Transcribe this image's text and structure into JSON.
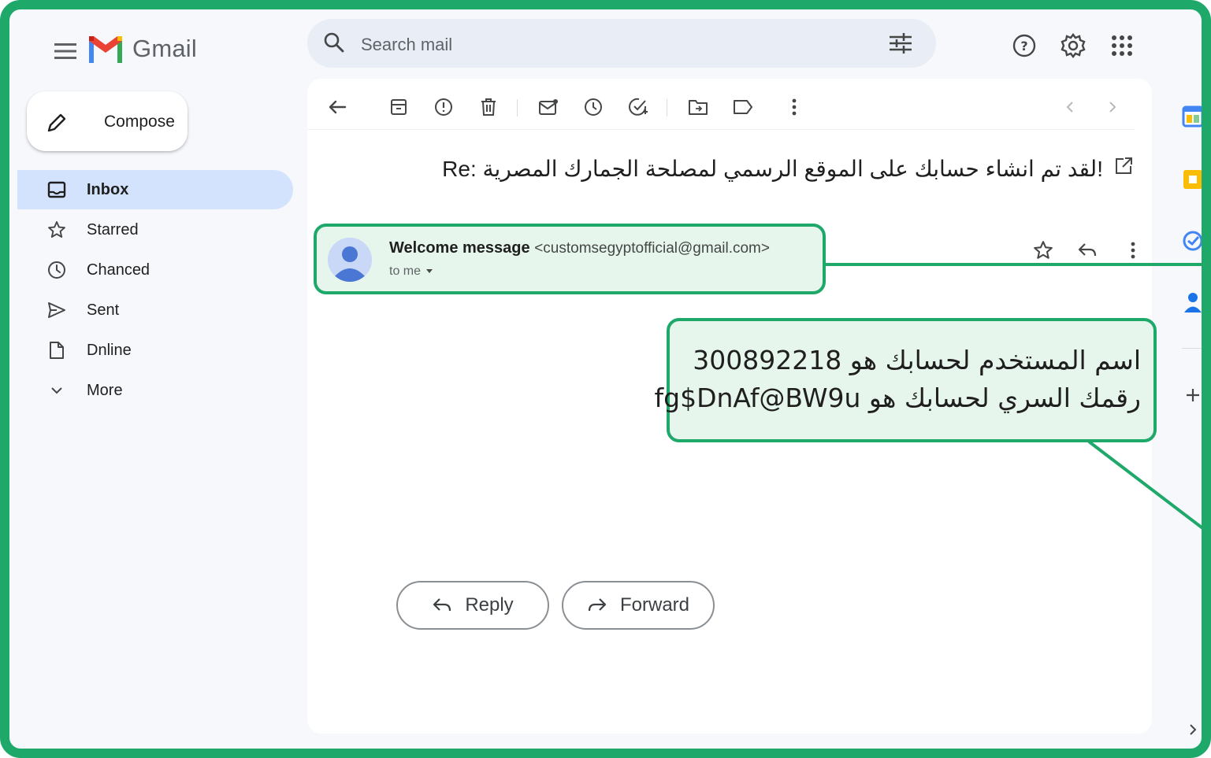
{
  "app": {
    "name": "Gmail"
  },
  "search": {
    "placeholder": "Search mail"
  },
  "compose": {
    "label": "Compose"
  },
  "nav": {
    "items": [
      {
        "label": "Inbox",
        "icon": "inbox-icon",
        "active": true
      },
      {
        "label": "Starred",
        "icon": "star-icon",
        "active": false
      },
      {
        "label": "Chanced",
        "icon": "clock-icon",
        "active": false
      },
      {
        "label": "Sent",
        "icon": "send-icon",
        "active": false
      },
      {
        "label": "Dnline",
        "icon": "file-icon",
        "active": false
      },
      {
        "label": "More",
        "icon": "chevron-down-icon",
        "active": false
      }
    ]
  },
  "email": {
    "subject": "Re: لقد تم انشاء حسابك على الموقع الرسمي لمصلحة الجمارك المصرية!",
    "sender_name": "Welcome message",
    "sender_email": "<customsegyptofficial@gmail.com>",
    "to_line": "to me",
    "body_lines": [
      "اسم المستخدم لحسابك هو 300892218",
      "رقمك السري لحسابك هو fg$DnAf@BW9u"
    ]
  },
  "actions": {
    "reply_label": "Reply",
    "forward_label": "Forward"
  },
  "colors": {
    "highlight_border": "#1ea86a",
    "highlight_fill": "#e7f6ec",
    "inbox_active": "#d3e3fd",
    "search_bg": "#e9eef6",
    "page_bg": "#f6f8fc"
  }
}
